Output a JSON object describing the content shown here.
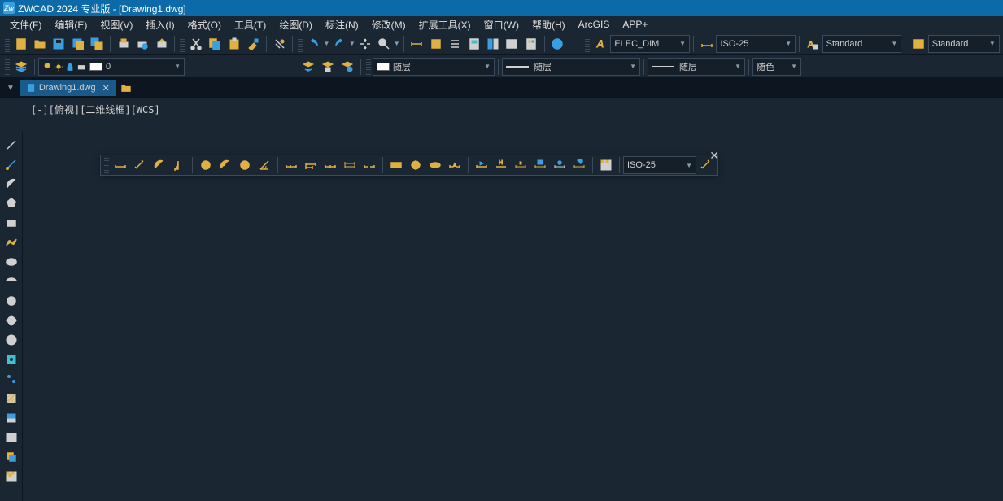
{
  "title": "ZWCAD 2024 专业版 - [Drawing1.dwg]",
  "menus": [
    "文件(F)",
    "编辑(E)",
    "视图(V)",
    "插入(I)",
    "格式(O)",
    "工具(T)",
    "绘图(D)",
    "标注(N)",
    "修改(M)",
    "扩展工具(X)",
    "窗口(W)",
    "帮助(H)",
    "ArcGIS",
    "APP+"
  ],
  "styles": {
    "dim_layer": "ELEC_DIM",
    "dim_style": "ISO-25",
    "text_style": "Standard",
    "table_style": "Standard"
  },
  "layer_props": {
    "layer_num": "0",
    "linetype": "随层",
    "lineweight": "随层",
    "color_bylayer": "随层",
    "bycolor": "随色"
  },
  "tab": {
    "name": "Drawing1.dwg"
  },
  "view_status": "[-][俯视][二维线框][WCS]",
  "float_dim_style": "ISO-25"
}
